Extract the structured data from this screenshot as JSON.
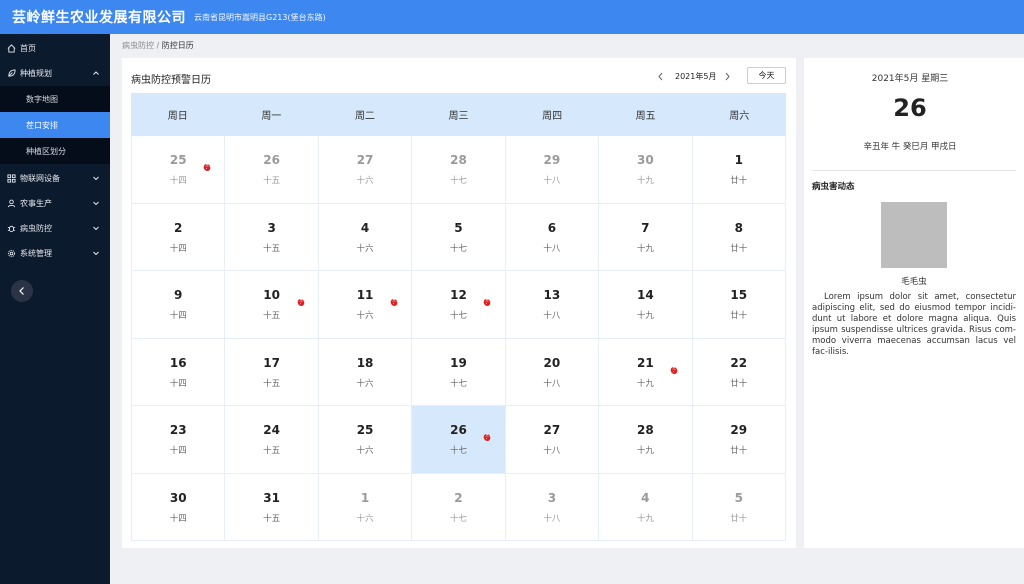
{
  "header": {
    "company": "芸岭鲜生农业发展有限公司",
    "address": "云南省昆明市嵩明县G213(堡台东路)"
  },
  "sidebar": {
    "home": "首页",
    "planting": {
      "label": "种植规划",
      "children": [
        "数字地图",
        "茬口安排",
        "种植区划分"
      ],
      "active_child": "茬口安排"
    },
    "iot": "物联网设备",
    "farming": "农事生产",
    "pest": "病虫防控",
    "system": "系统管理"
  },
  "breadcrumb": {
    "parent": "病虫防控",
    "separator": "/",
    "current": "防控日历"
  },
  "calendar": {
    "title": "病虫防控预警日历",
    "month_label": "2021年5月",
    "today_label": "今天",
    "weekdays": [
      "周日",
      "周一",
      "周二",
      "周三",
      "周四",
      "周五",
      "周六"
    ],
    "weeks": [
      [
        {
          "d": "25",
          "l": "十四",
          "other": true,
          "pest": true
        },
        {
          "d": "26",
          "l": "十五",
          "other": true
        },
        {
          "d": "27",
          "l": "十六",
          "other": true
        },
        {
          "d": "28",
          "l": "十七",
          "other": true
        },
        {
          "d": "29",
          "l": "十八",
          "other": true
        },
        {
          "d": "30",
          "l": "十九",
          "other": true
        },
        {
          "d": "1",
          "l": "廿十"
        }
      ],
      [
        {
          "d": "2",
          "l": "十四"
        },
        {
          "d": "3",
          "l": "十五"
        },
        {
          "d": "4",
          "l": "十六"
        },
        {
          "d": "5",
          "l": "十七"
        },
        {
          "d": "6",
          "l": "十八"
        },
        {
          "d": "7",
          "l": "十九"
        },
        {
          "d": "8",
          "l": "廿十"
        }
      ],
      [
        {
          "d": "9",
          "l": "十四"
        },
        {
          "d": "10",
          "l": "十五",
          "pest": true
        },
        {
          "d": "11",
          "l": "十六",
          "pest": true
        },
        {
          "d": "12",
          "l": "十七",
          "pest": true
        },
        {
          "d": "13",
          "l": "十八"
        },
        {
          "d": "14",
          "l": "十九"
        },
        {
          "d": "15",
          "l": "廿十"
        }
      ],
      [
        {
          "d": "16",
          "l": "十四"
        },
        {
          "d": "17",
          "l": "十五"
        },
        {
          "d": "18",
          "l": "十六"
        },
        {
          "d": "19",
          "l": "十七"
        },
        {
          "d": "20",
          "l": "十八"
        },
        {
          "d": "21",
          "l": "十九",
          "pest": true
        },
        {
          "d": "22",
          "l": "廿十"
        }
      ],
      [
        {
          "d": "23",
          "l": "十四"
        },
        {
          "d": "24",
          "l": "十五"
        },
        {
          "d": "25",
          "l": "十六"
        },
        {
          "d": "26",
          "l": "十七",
          "selected": true,
          "pest": true
        },
        {
          "d": "27",
          "l": "十八"
        },
        {
          "d": "28",
          "l": "十九"
        },
        {
          "d": "29",
          "l": "廿十"
        }
      ],
      [
        {
          "d": "30",
          "l": "十四"
        },
        {
          "d": "31",
          "l": "十五"
        },
        {
          "d": "1",
          "l": "十六",
          "other": true
        },
        {
          "d": "2",
          "l": "十七",
          "other": true
        },
        {
          "d": "3",
          "l": "十八",
          "other": true
        },
        {
          "d": "4",
          "l": "十九",
          "other": true
        },
        {
          "d": "5",
          "l": "廿十",
          "other": true
        }
      ]
    ]
  },
  "detail": {
    "date_line": "2021年5月 星期三",
    "day": "26",
    "lunar": "辛丑年 牛  癸巳月 甲戌日",
    "section_title": "病虫害动态",
    "pest_name": "毛毛虫",
    "description": "Lorem ipsum dolor sit amet, consectetur adipiscing elit, sed do eiusmod tempor incidi-dunt ut labore et dolore magna aliqua. Quis ipsum suspendisse ultrices gravida. Risus com-modo viverra maecenas accumsan lacus vel fac-ilisis."
  },
  "colors": {
    "header": "#3c87f0",
    "sidebar": "#0c1a2e",
    "active": "#3c87f0",
    "weekday_header": "#d6e8fb",
    "pest_marker": "#e02020"
  }
}
